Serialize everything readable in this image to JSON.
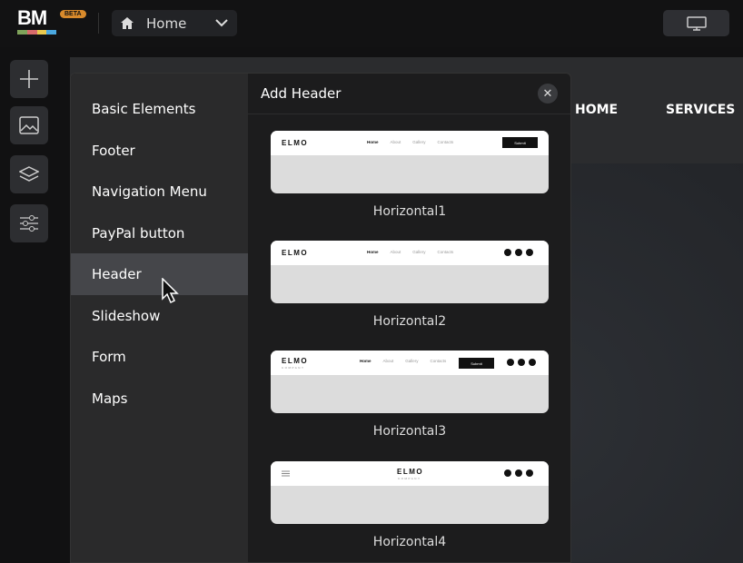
{
  "topbar": {
    "logo": "BM",
    "beta": "BETA",
    "page": "Home",
    "logo_colors": [
      "#7fa35b",
      "#d86b6b",
      "#e8c94f",
      "#4aa8e0"
    ]
  },
  "site_nav": {
    "items": [
      "HOME",
      "SERVICES"
    ]
  },
  "panel": {
    "title": "Add Header",
    "categories": [
      "Basic Elements",
      "Footer",
      "Navigation Menu",
      "PayPal button",
      "Header",
      "Slideshow",
      "Form",
      "Maps"
    ],
    "active_category": "Header",
    "templates": [
      {
        "label": "Horizontal1",
        "brand": "ELMO",
        "links": [
          "Home",
          "About",
          "Gallery",
          "Contacts"
        ],
        "button": "Submit"
      },
      {
        "label": "Horizontal2",
        "brand": "ELMO",
        "links": [
          "Home",
          "About",
          "Gallery",
          "Contacts"
        ]
      },
      {
        "label": "Horizontal3",
        "brand": "ELMO",
        "tagline": "COMPANY",
        "links": [
          "Home",
          "About",
          "Gallery",
          "Contacts"
        ],
        "button": "Submit"
      },
      {
        "label": "Horizontal4",
        "brand": "ELMO",
        "tagline": "COMPANY"
      }
    ]
  }
}
